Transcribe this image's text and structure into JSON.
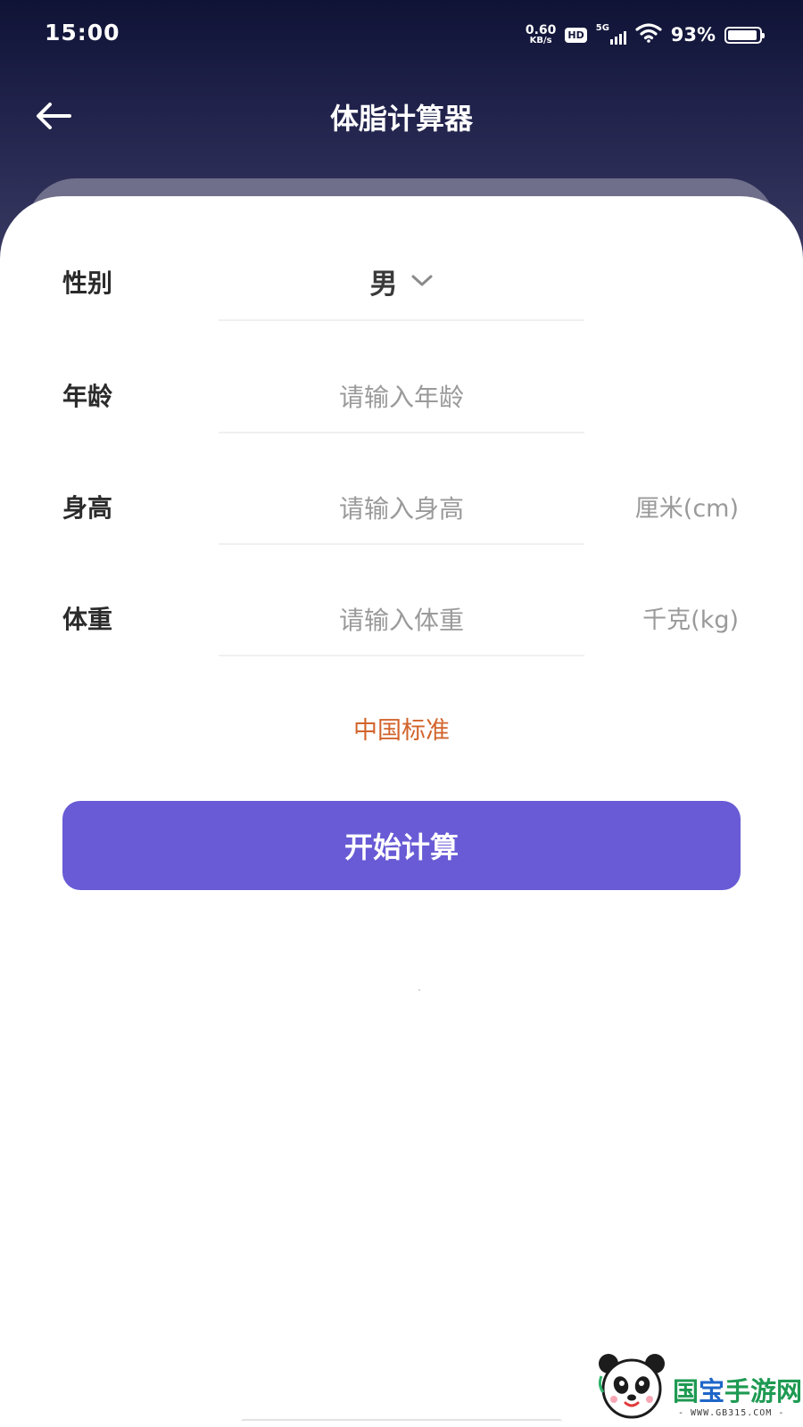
{
  "status_bar": {
    "time": "15:00",
    "net_speed_value": "0.60",
    "net_speed_unit": "KB/s",
    "hd_badge": "HD",
    "network_type": "5G",
    "battery_percent": "93%",
    "battery_level": 0.93
  },
  "header": {
    "title": "体脂计算器",
    "back_icon": "arrow-left-icon"
  },
  "form": {
    "gender": {
      "label": "性别",
      "value": "男",
      "dropdown_icon": "chevron-down-icon"
    },
    "age": {
      "label": "年龄",
      "value": "",
      "placeholder": "请输入年龄"
    },
    "height": {
      "label": "身高",
      "value": "",
      "placeholder": "请输入身高",
      "unit": "厘米(cm)"
    },
    "weight": {
      "label": "体重",
      "value": "",
      "placeholder": "请输入体重",
      "unit": "千克(kg)"
    },
    "standard_link": "中国标准",
    "submit_label": "开始计算"
  },
  "watermark": {
    "brand_parts": [
      "国",
      "宝",
      "手游网"
    ],
    "url": "- WWW.GB315.COM -"
  },
  "colors": {
    "header_dark": "#0f1335",
    "primary_button": "#685bd5",
    "standard_link": "#d2642c",
    "label_text": "#2b2b2b",
    "placeholder_text": "#9a9a9a"
  }
}
